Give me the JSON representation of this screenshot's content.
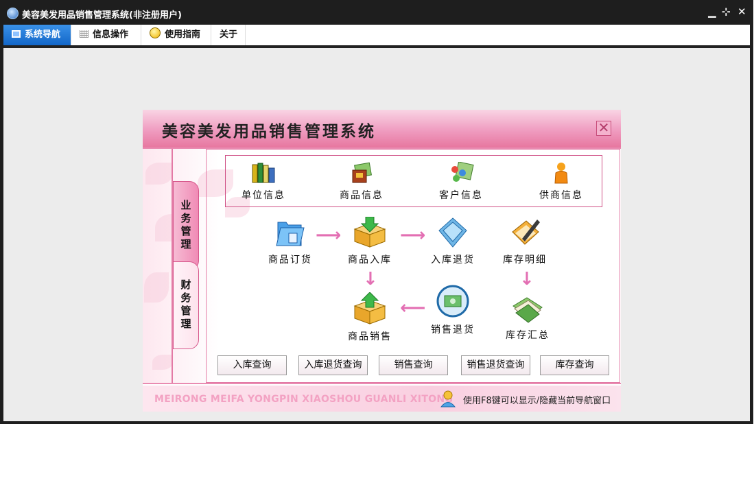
{
  "window": {
    "title": "美容美发用品销售管理系统(非注册用户)",
    "controls": {
      "minimize": "▁",
      "restore": "⊹",
      "close": "✕"
    }
  },
  "menu": {
    "tabs": [
      {
        "label": "系统导航",
        "icon": "monitor-icon",
        "active": true
      },
      {
        "label": "信息操作",
        "icon": "grid-icon",
        "active": false
      },
      {
        "label": "使用指南",
        "icon": "help-bulb-icon",
        "active": false
      },
      {
        "label": "关于",
        "icon": "",
        "active": false
      }
    ]
  },
  "panel": {
    "title": "美容美发用品销售管理系统",
    "close_glyph": "✕",
    "side_tabs": [
      {
        "label": "业务管理",
        "active": true
      },
      {
        "label": "财务管理",
        "active": false
      }
    ],
    "info_items": [
      {
        "label": "单位信息",
        "icon": "books-icon"
      },
      {
        "label": "商品信息",
        "icon": "product-box-icon"
      },
      {
        "label": "客户信息",
        "icon": "customers-icon"
      },
      {
        "label": "供商信息",
        "icon": "supplier-person-icon"
      }
    ],
    "flow": {
      "order": "商品订货",
      "stock_in": "商品入库",
      "stock_in_return": "入库退货",
      "inventory_detail": "库存明细",
      "sale": "商品销售",
      "sale_return": "销售退货",
      "inventory_summary": "库存汇总"
    },
    "query_buttons": [
      "入库查询",
      "入库退货查询",
      "销售查询",
      "销售退货查询",
      "库存查询"
    ],
    "footer_pinyin": "MEIRONG MEIFA YONGPIN XIAOSHOU GUANLI XITONG",
    "footer_tip": "使用F8键可以显示/隐藏当前导航窗口"
  },
  "colors": {
    "accent_pink": "#e7779f",
    "active_tab_blue": "#1266c8",
    "arrow_pink": "#e36fb3"
  }
}
